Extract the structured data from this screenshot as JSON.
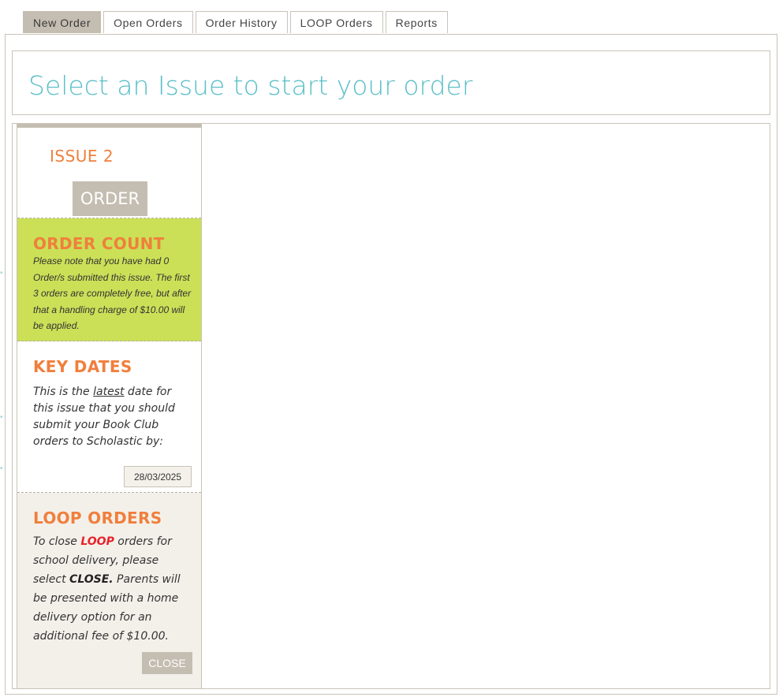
{
  "tabs": [
    {
      "label": "New Order",
      "active": true
    },
    {
      "label": "Open Orders",
      "active": false
    },
    {
      "label": "Order History",
      "active": false
    },
    {
      "label": "LOOP Orders",
      "active": false
    },
    {
      "label": "Reports",
      "active": false
    }
  ],
  "header": {
    "title": "Select an Issue to start your order"
  },
  "issue": {
    "title": "ISSUE 2",
    "order_label": "ORDER"
  },
  "order_count": {
    "heading": "ORDER COUNT",
    "text": "Please note that you have had 0 Order/s submitted this issue. The first 3 orders are completely free, but after that a handling charge of $10.00 will be applied."
  },
  "key_dates": {
    "heading": "KEY DATES",
    "text_before": "This is the ",
    "text_underlined": "latest",
    "text_after": " date for this issue that you should submit your Book Club orders to Scholastic by:",
    "date_value": "28/03/2025"
  },
  "loop_orders": {
    "heading": "LOOP ORDERS",
    "text_1": "To close ",
    "text_loop": "LOOP",
    "text_2": " orders for school delivery, please select ",
    "text_close": "CLOSE.",
    "text_3": " Parents will be presented with a home delivery option for an additional fee of $10.00.",
    "close_label": "CLOSE"
  },
  "colors": {
    "accent_teal": "#5bbfc8",
    "accent_orange": "#f07f3c",
    "count_green": "#cbe057",
    "button_taupe": "#c4bdb1",
    "loop_red": "#e8232a"
  }
}
